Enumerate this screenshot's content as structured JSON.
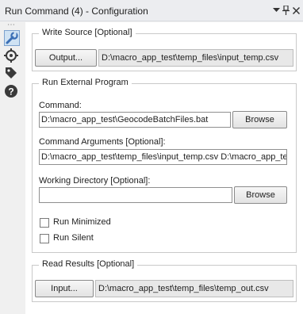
{
  "window": {
    "title": "Run Command (4) - Configuration",
    "dropdown_icon": "dropdown-arrow-icon",
    "pin_icon": "pin-icon",
    "close_icon": "close-icon"
  },
  "toolbar": {
    "tools": [
      {
        "icon": "wrench-icon",
        "selected": true
      },
      {
        "icon": "target-icon",
        "selected": false
      },
      {
        "icon": "tag-icon",
        "selected": false
      },
      {
        "icon": "help-icon",
        "selected": false
      }
    ],
    "accent": "#3b7bbf"
  },
  "write_source": {
    "legend": "Write Source [Optional]",
    "button_label": "Output...",
    "path": "D:\\macro_app_test\\temp_files\\input_temp.csv"
  },
  "run_external": {
    "legend": "Run External Program",
    "command_label": "Command:",
    "command_value": "D:\\macro_app_test\\GeocodeBatchFiles.bat",
    "command_browse": "Browse",
    "args_label": "Command Arguments [Optional]:",
    "args_value": "D:\\macro_app_test\\temp_files\\input_temp.csv D:\\macro_app_te",
    "workdir_label": "Working Directory [Optional]:",
    "workdir_value": "",
    "workdir_browse": "Browse",
    "run_minimized_label": "Run Minimized",
    "run_minimized_checked": false,
    "run_silent_label": "Run Silent",
    "run_silent_checked": false
  },
  "read_results": {
    "legend": "Read Results [Optional]",
    "button_label": "Input...",
    "path": "D:\\macro_app_test\\temp_files\\temp_out.csv"
  }
}
